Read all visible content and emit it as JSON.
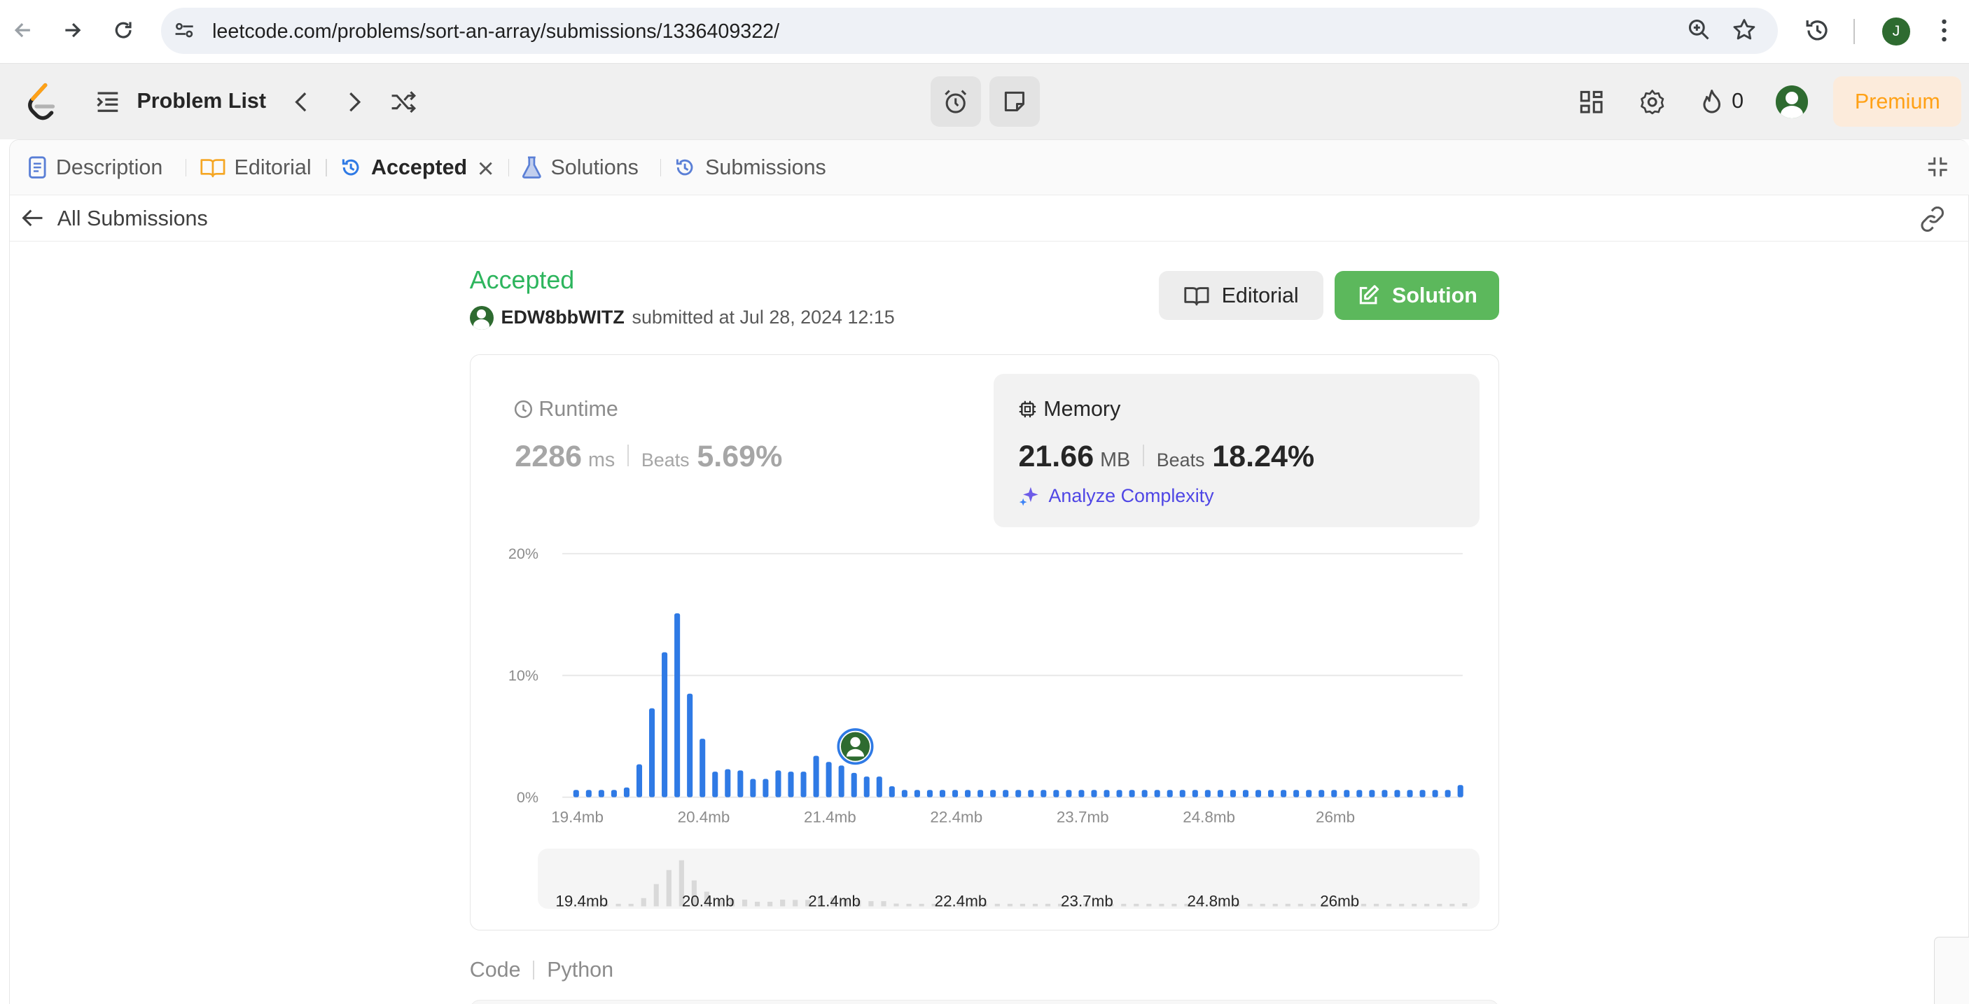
{
  "browser": {
    "url": "leetcode.com/problems/sort-an-array/submissions/1336409322/",
    "profile_initial": "J"
  },
  "header": {
    "problem_list": "Problem List",
    "streak_count": "0",
    "premium": "Premium"
  },
  "tabs": {
    "description": "Description",
    "editorial": "Editorial",
    "accepted": "Accepted",
    "solutions": "Solutions",
    "submissions": "Submissions"
  },
  "subbar": {
    "back_label": "All Submissions"
  },
  "submission": {
    "status": "Accepted",
    "username": "EDW8bbWITZ",
    "submitted_text": "submitted at Jul 28, 2024 12:15",
    "editorial_button": "Editorial",
    "solution_button": "Solution"
  },
  "runtime": {
    "title": "Runtime",
    "value": "2286",
    "unit": "ms",
    "beats_label": "Beats",
    "beats_value": "5.69%"
  },
  "memory": {
    "title": "Memory",
    "value": "21.66",
    "unit": "MB",
    "beats_label": "Beats",
    "beats_value": "18.24%",
    "analyze_label": "Analyze Complexity"
  },
  "code": {
    "label": "Code",
    "language": "Python"
  },
  "colors": {
    "accepted": "#2db55d",
    "bar": "#2f7ae5",
    "premium": "#ffa116",
    "analyze": "#4f46e5"
  },
  "chart_data": {
    "type": "bar",
    "title": "",
    "xlabel": "",
    "ylabel": "",
    "ylim": [
      0,
      20
    ],
    "y_ticks": [
      "0%",
      "10%",
      "20%"
    ],
    "x_ticks": [
      "19.4mb",
      "20.4mb",
      "21.4mb",
      "22.4mb",
      "23.7mb",
      "24.8mb",
      "26mb"
    ],
    "values": [
      0.6,
      0.6,
      0.6,
      0.6,
      0.8,
      2.7,
      7.3,
      11.9,
      15.1,
      8.5,
      4.8,
      2.1,
      2.3,
      2.2,
      1.5,
      1.5,
      2.2,
      2.1,
      2.1,
      3.4,
      2.9,
      2.6,
      2.0,
      1.7,
      1.7,
      0.9,
      0.6,
      0.6,
      0.6,
      0.6,
      0.6,
      0.6,
      0.6,
      0.6,
      0.6,
      0.6,
      0.6,
      0.6,
      0.6,
      0.6,
      0.6,
      0.6,
      0.6,
      0.6,
      0.6,
      0.6,
      0.6,
      0.6,
      0.6,
      0.6,
      0.6,
      0.6,
      0.6,
      0.6,
      0.6,
      0.6,
      0.6,
      0.6,
      0.6,
      0.6,
      0.6,
      0.6,
      0.6,
      0.6,
      0.6,
      0.6,
      0.6,
      0.6,
      0.6,
      0.6,
      1.0
    ],
    "user_bar_index": 22,
    "grid": true
  }
}
